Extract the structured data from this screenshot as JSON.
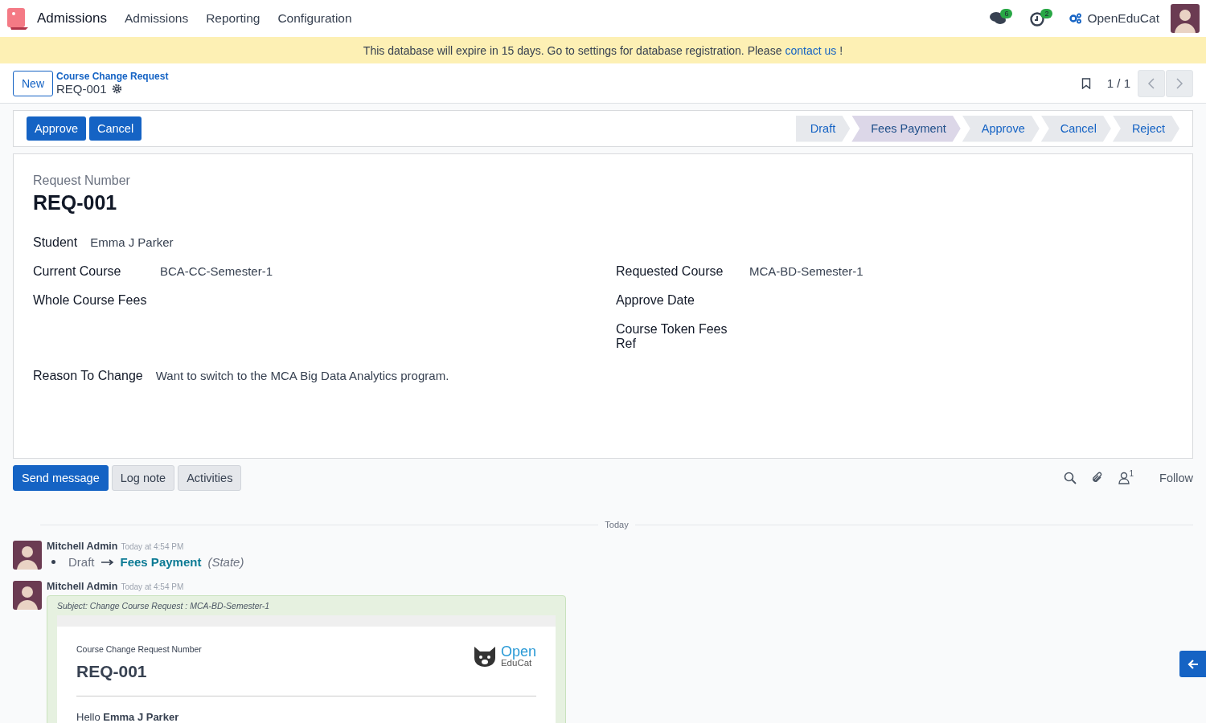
{
  "navbar": {
    "app_name": "Admissions",
    "menu": [
      "Admissions",
      "Reporting",
      "Configuration"
    ],
    "messages_count": "6",
    "activities_count": "2",
    "company": "OpenEduCat"
  },
  "banner": {
    "text": "This database will expire in 15 days. Go to settings for database registration. Please",
    "link": "contact us",
    "suffix": "!"
  },
  "control_panel": {
    "new_button": "New",
    "breadcrumb": "Course Change Request",
    "record": "REQ-001",
    "pager": "1 / 1"
  },
  "header": {
    "buttons": [
      "Approve",
      "Cancel"
    ],
    "statusbar": [
      {
        "label": "Draft",
        "selected": false
      },
      {
        "label": "Fees Payment",
        "selected": true
      },
      {
        "label": "Approve",
        "selected": false
      },
      {
        "label": "Cancel",
        "selected": false
      },
      {
        "label": "Reject",
        "selected": false
      }
    ]
  },
  "form": {
    "title_label": "Request Number",
    "title": "REQ-001",
    "student": {
      "label": "Student",
      "value": "Emma J Parker"
    },
    "left_fields": [
      {
        "label": "Current Course",
        "value": "BCA-CC-Semester-1"
      },
      {
        "label": "Whole Course Fees"
      }
    ],
    "right_fields": [
      {
        "label": "Requested Course",
        "value": "MCA-BD-Semester-1"
      },
      {
        "label": "Approve Date"
      },
      {
        "label": "Course Token Fees Ref"
      }
    ],
    "reason": {
      "label": "Reason To Change",
      "value": "Want to switch to the MCA Big Data Analytics program."
    }
  },
  "chatter": {
    "buttons": [
      {
        "label": "Send message",
        "kind": "primary"
      },
      {
        "label": "Log note",
        "kind": "secondary"
      },
      {
        "label": "Activities",
        "kind": "secondary"
      }
    ],
    "follower_count": "1",
    "follow": "Follow",
    "date_separator": "Today",
    "messages": [
      {
        "kind": "tracking",
        "author": "Mitchell Admin",
        "time": "Today at 4:54 PM",
        "old_value": "Draft",
        "new_value": "Fees Payment",
        "field": "(State)"
      },
      {
        "kind": "email",
        "author": "Mitchell Admin",
        "time": "Today at 4:54 PM",
        "subject": "Subject: Change Course Request : MCA-BD-Semester-1",
        "number_label": "Course Change Request Number",
        "number": "REQ-001",
        "logo_top": "Open",
        "logo_bottom": "EduCat",
        "greeting": "Hello **Emma J Parker**"
      }
    ]
  }
}
